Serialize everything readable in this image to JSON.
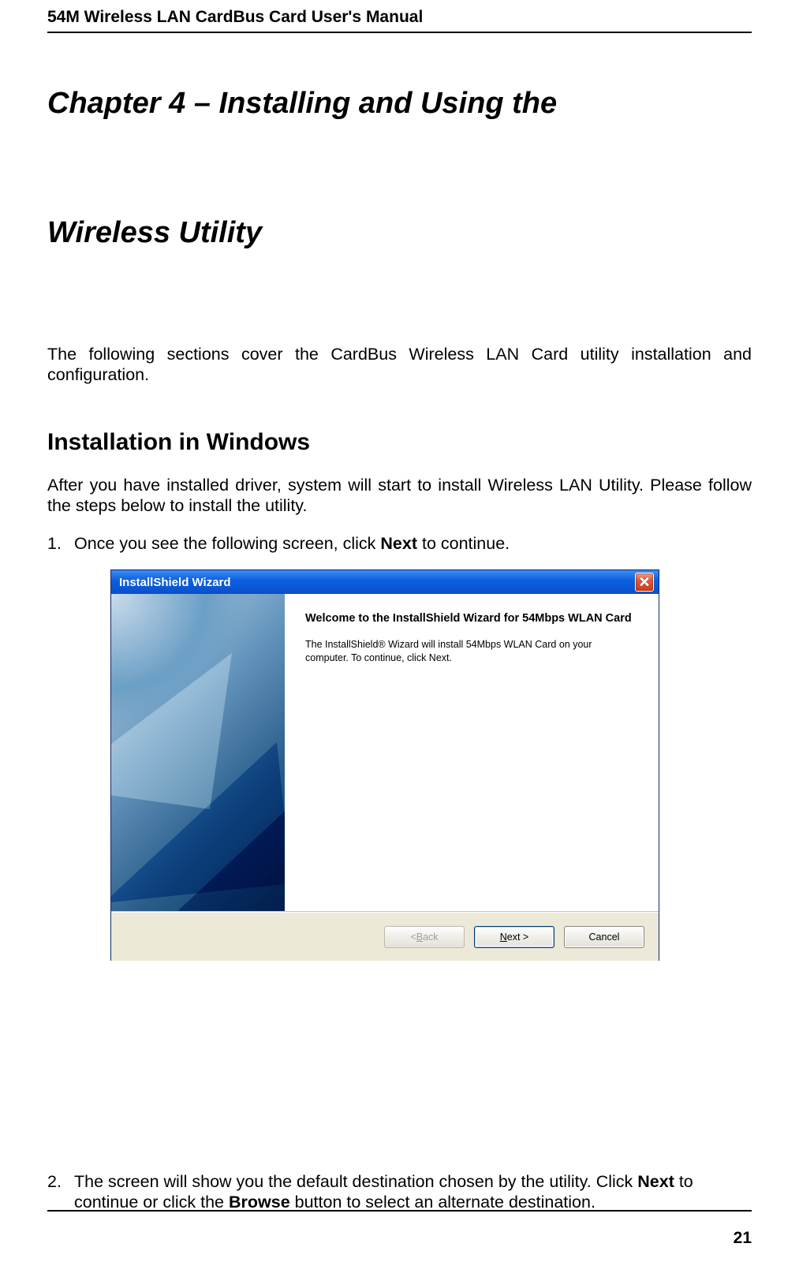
{
  "header": {
    "title": "54M Wireless LAN CardBus Card User's Manual"
  },
  "chapter": {
    "line1": "Chapter 4 – Installing and Using the",
    "line2": "Wireless Utility"
  },
  "intro": "The following sections cover the CardBus Wireless LAN Card utility installation and configuration.",
  "section": {
    "title": "Installation in Windows"
  },
  "section_intro": "After you have installed driver, system will start to install Wireless LAN Utility. Please follow the steps below to install the utility.",
  "steps": {
    "s1": {
      "num": "1.",
      "pre": "Once you see the following screen, click ",
      "bold": "Next",
      "post": " to continue."
    },
    "s2": {
      "num": "2.",
      "pre": "The screen will show you the default destination chosen by the utility. Click ",
      "bold1": "Next",
      "mid": " to continue or click the ",
      "bold2": "Browse",
      "post": " button to select an alternate destination."
    }
  },
  "dialog": {
    "title": "InstallShield Wizard",
    "heading": "Welcome to the InstallShield Wizard for 54Mbps WLAN Card",
    "body": "The InstallShield® Wizard will install 54Mbps WLAN Card on your computer.  To continue, click Next.",
    "buttons": {
      "back_pre": "< ",
      "back_u": "B",
      "back_post": "ack",
      "next_u": "N",
      "next_post": "ext >",
      "cancel": "Cancel"
    }
  },
  "page_number": "21"
}
